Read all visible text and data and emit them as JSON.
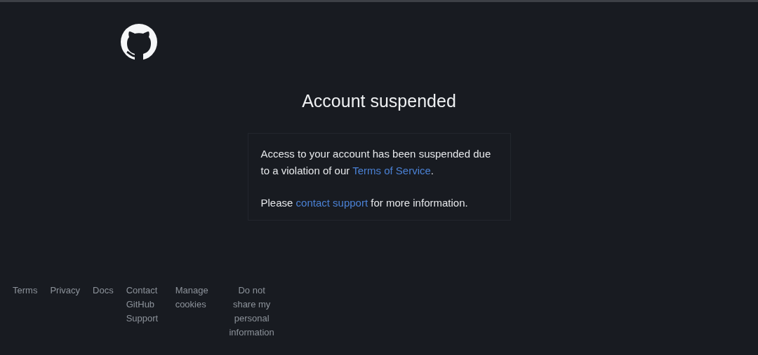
{
  "heading": "Account suspended",
  "message": [
    {
      "before": "Access to your account has been suspended due to a violation of our ",
      "link": "Terms of Service",
      "after": "."
    },
    {
      "before": "Please ",
      "link": "contact support",
      "after": " for more information."
    }
  ],
  "footer_links": [
    "Terms",
    "Privacy",
    "Docs",
    "Contact GitHub Support",
    "Manage cookies",
    "Do not share my personal information"
  ]
}
